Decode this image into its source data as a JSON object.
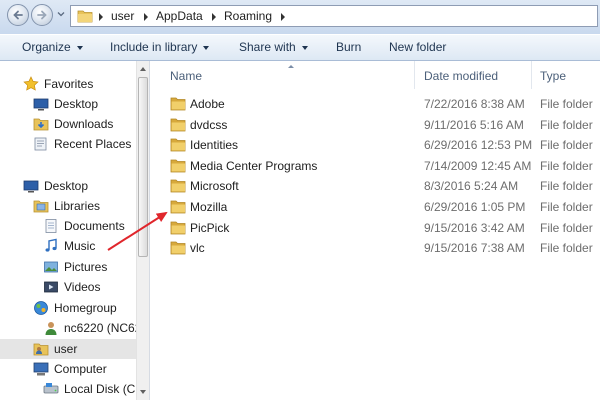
{
  "address": {
    "crumbs": [
      "user",
      "AppData",
      "Roaming"
    ]
  },
  "toolbar": {
    "organize": "Organize",
    "include": "Include in library",
    "share": "Share with",
    "burn": "Burn",
    "new_folder": "New folder"
  },
  "nav": {
    "favorites": "Favorites",
    "desktop_fav": "Desktop",
    "downloads": "Downloads",
    "recent": "Recent Places",
    "desktop": "Desktop",
    "libraries": "Libraries",
    "documents": "Documents",
    "music": "Music",
    "pictures": "Pictures",
    "videos": "Videos",
    "homegroup": "Homegroup",
    "nc6220": "nc6220 (NC62",
    "user": "user",
    "computer": "Computer",
    "localdisk": "Local Disk (C:"
  },
  "columns": {
    "name": "Name",
    "date": "Date modified",
    "type": "Type"
  },
  "files": [
    {
      "name": "Adobe",
      "date": "7/22/2016 8:38 AM",
      "type": "File folder"
    },
    {
      "name": "dvdcss",
      "date": "9/11/2016 5:16 AM",
      "type": "File folder"
    },
    {
      "name": "Identities",
      "date": "6/29/2016 12:53 PM",
      "type": "File folder"
    },
    {
      "name": "Media Center Programs",
      "date": "7/14/2009 12:45 AM",
      "type": "File folder"
    },
    {
      "name": "Microsoft",
      "date": "8/3/2016 5:24 AM",
      "type": "File folder"
    },
    {
      "name": "Mozilla",
      "date": "6/29/2016 1:05 PM",
      "type": "File folder"
    },
    {
      "name": "PicPick",
      "date": "9/15/2016 3:42 AM",
      "type": "File folder"
    },
    {
      "name": "vlc",
      "date": "9/15/2016 7:38 AM",
      "type": "File folder"
    }
  ],
  "colors": {
    "folder": "#e8c35a",
    "arrow": "#e0262c"
  }
}
